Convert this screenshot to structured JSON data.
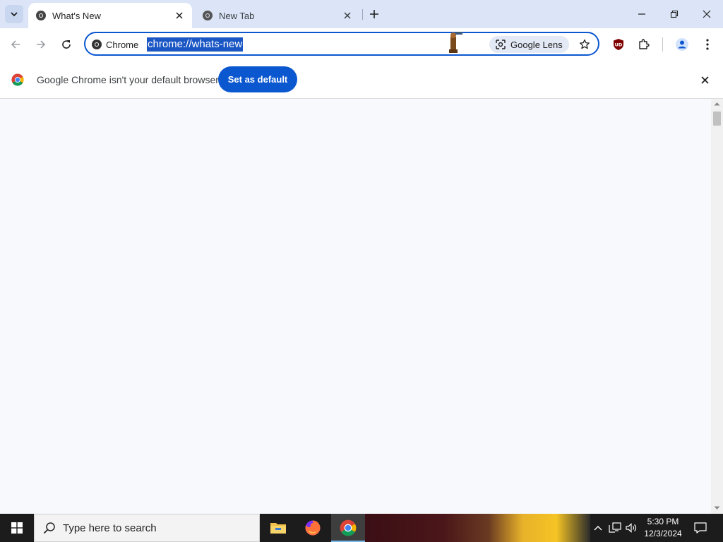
{
  "tabs": [
    {
      "title": "What's New",
      "active": true
    },
    {
      "title": "New Tab",
      "active": false
    }
  ],
  "toolbar": {
    "site_chip": "Chrome",
    "url": "chrome://whats-new",
    "lens_label": "Google Lens",
    "extension_badge": "UD"
  },
  "infobar": {
    "message": "Google Chrome isn't your default browser",
    "button_label": "Set as default"
  },
  "taskbar": {
    "search_placeholder": "Type here to search",
    "time": "5:30 PM",
    "date": "12/3/2024"
  },
  "colors": {
    "accent": "#0b57d0",
    "tabstrip": "#dbe5f7",
    "content_bg": "#f8f9fc"
  }
}
